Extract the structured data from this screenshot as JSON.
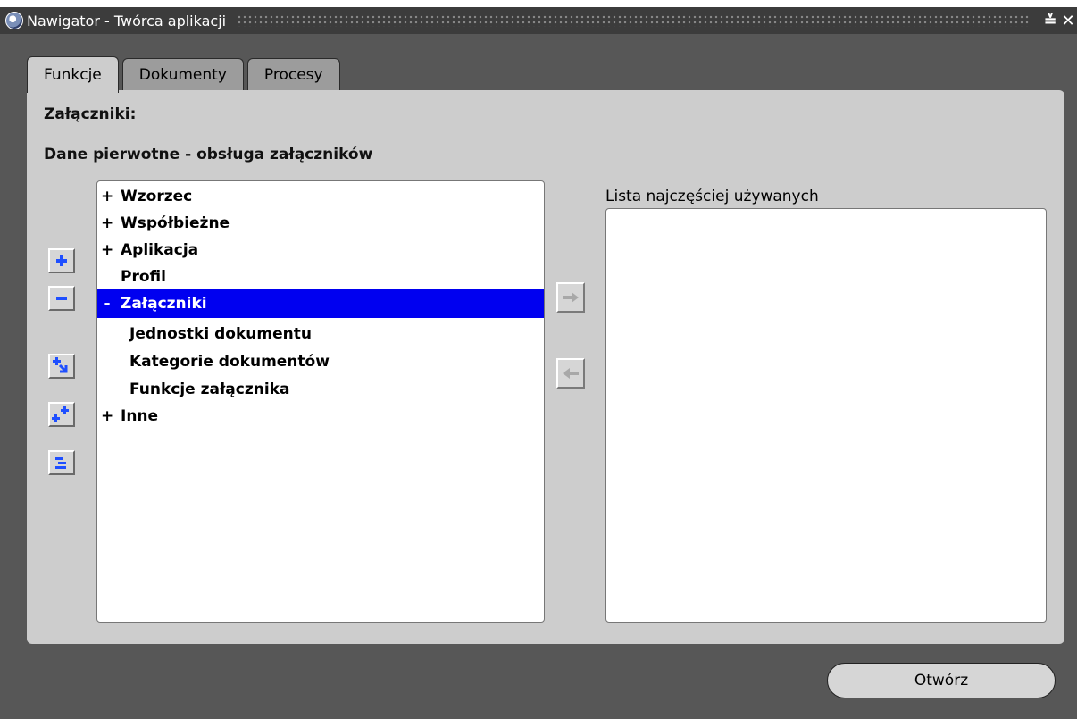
{
  "window": {
    "title": "Nawigator - Twórca aplikacji",
    "minimize_glyph": "≚",
    "close_glyph": "✕"
  },
  "tabs": [
    {
      "label": "Funkcje",
      "active": true
    },
    {
      "label": "Dokumenty",
      "active": false
    },
    {
      "label": "Procesy",
      "active": false
    }
  ],
  "panel": {
    "section_label": "Załączniki:",
    "subtitle": "Dane pierwotne - obsługa załączników"
  },
  "tree": {
    "items": [
      {
        "expander": "+",
        "label": "Wzorzec",
        "indent": 0
      },
      {
        "expander": "+",
        "label": "Współbieżne",
        "indent": 0
      },
      {
        "expander": "+",
        "label": "Aplikacja",
        "indent": 0
      },
      {
        "expander": "",
        "label": "Profil",
        "indent": 0
      },
      {
        "expander": "-",
        "label": "Załączniki",
        "indent": 0,
        "selected": true
      },
      {
        "expander": "",
        "label": "Jednostki dokumentu",
        "indent": 1
      },
      {
        "expander": "",
        "label": "Kategorie dokumentów",
        "indent": 1
      },
      {
        "expander": "",
        "label": "Funkcje załącznika",
        "indent": 1
      },
      {
        "expander": "+",
        "label": "Inne",
        "indent": 0
      }
    ]
  },
  "tree_buttons": [
    {
      "icon": "expand-plus-icon"
    },
    {
      "icon": "collapse-minus-icon"
    },
    {
      "icon": "expand-branch-icon"
    },
    {
      "icon": "expand-all-icon"
    },
    {
      "icon": "collapse-all-icon"
    }
  ],
  "move_buttons": [
    {
      "icon": "arrow-right-icon",
      "enabled": false
    },
    {
      "icon": "arrow-left-icon",
      "enabled": false
    }
  ],
  "favorites": {
    "label": "Lista najczęściej używanych",
    "items": []
  },
  "footer": {
    "open_button": "Otwórz"
  },
  "colors": {
    "selection": "#0000f0",
    "icon_blue": "#1f4fff",
    "panel": "#cdcdcd",
    "window_bg": "#575757"
  }
}
